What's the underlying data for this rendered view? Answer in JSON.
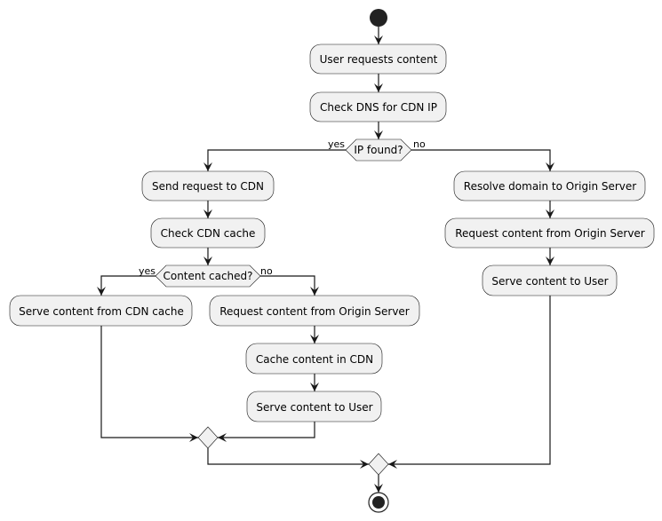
{
  "diagram": {
    "type": "activity",
    "colors": {
      "node_fill": "#f1f1f1",
      "line": "#181818",
      "start_end": "#222222"
    },
    "actions": {
      "user_requests": "User requests content",
      "check_dns": "Check DNS for CDN IP",
      "send_request": "Send request to CDN",
      "check_cache": "Check CDN cache",
      "serve_from_cache": "Serve content from CDN cache",
      "request_origin_cached_no": "Request content from Origin Server",
      "cache_in_cdn": "Cache content in CDN",
      "serve_user_left": "Serve content to User",
      "resolve_domain": "Resolve domain to Origin Server",
      "request_origin_right": "Request content from Origin Server",
      "serve_user_right": "Serve content to User"
    },
    "decisions": {
      "ip_found": {
        "question": "IP found?",
        "yes": "yes",
        "no": "no"
      },
      "content_cached": {
        "question": "Content cached?",
        "yes": "yes",
        "no": "no"
      }
    }
  }
}
